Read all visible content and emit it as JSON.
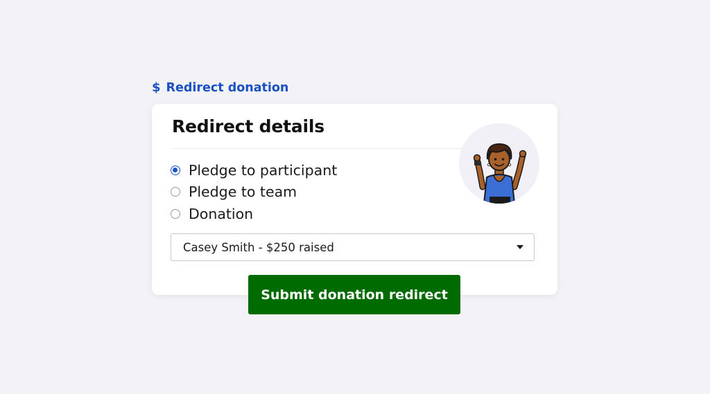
{
  "section_link": {
    "icon": "dollar-icon",
    "label": "Redirect donation",
    "color": "#1a52c4"
  },
  "card": {
    "title": "Redirect details",
    "avatar_icon": "participant-celebrating-illustration"
  },
  "radio_options": [
    {
      "label": "Pledge to participant",
      "checked": true
    },
    {
      "label": "Pledge to team",
      "checked": false
    },
    {
      "label": "Donation",
      "checked": false
    }
  ],
  "participant_select": {
    "value": "Casey Smith - $250 raised",
    "icon": "caret-down-icon"
  },
  "submit_button": {
    "label": "Submit donation redirect",
    "color": "#006b00"
  }
}
